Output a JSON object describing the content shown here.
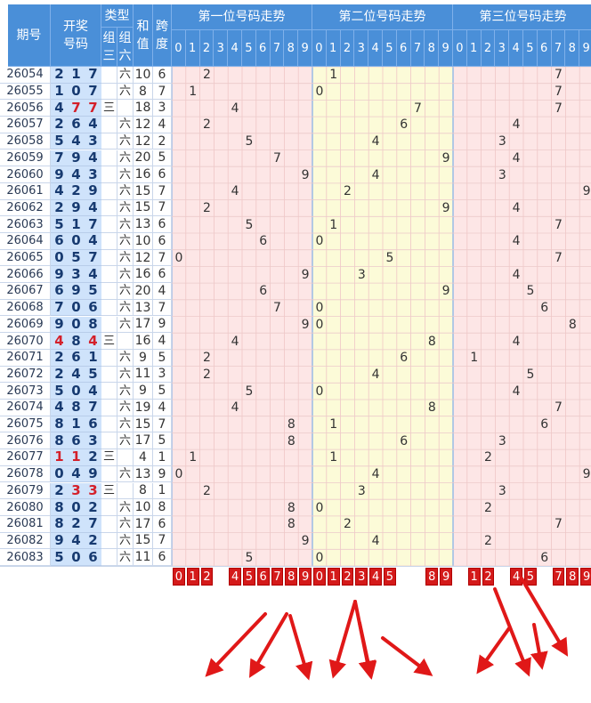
{
  "headers": {
    "issue": "期号",
    "draw_line1": "开奖",
    "draw_line2": "号码",
    "type": "类型",
    "type_g3_line1": "组",
    "type_g3_line2": "三",
    "type_g6_line1": "组",
    "type_g6_line2": "六",
    "sum_line1": "和",
    "sum_line2": "值",
    "span_line1": "跨",
    "span_line2": "度"
  },
  "sections": [
    {
      "title": "第一位号码走势"
    },
    {
      "title": "第二位号码走势"
    },
    {
      "title": "第三位号码走势"
    }
  ],
  "digit_labels": [
    "0",
    "1",
    "2",
    "3",
    "4",
    "5",
    "6",
    "7",
    "8",
    "9"
  ],
  "rows": [
    {
      "issue": "26054",
      "n": [
        "2",
        "1",
        "7"
      ],
      "red": [
        false,
        false,
        false
      ],
      "g3": "",
      "g6": "六",
      "sum": "10",
      "span": "6"
    },
    {
      "issue": "26055",
      "n": [
        "1",
        "0",
        "7"
      ],
      "red": [
        false,
        false,
        false
      ],
      "g3": "",
      "g6": "六",
      "sum": "8",
      "span": "7"
    },
    {
      "issue": "26056",
      "n": [
        "4",
        "7",
        "7"
      ],
      "red": [
        false,
        true,
        true
      ],
      "g3": "三",
      "g6": "",
      "sum": "18",
      "span": "3"
    },
    {
      "issue": "26057",
      "n": [
        "2",
        "6",
        "4"
      ],
      "red": [
        false,
        false,
        false
      ],
      "g3": "",
      "g6": "六",
      "sum": "12",
      "span": "4"
    },
    {
      "issue": "26058",
      "n": [
        "5",
        "4",
        "3"
      ],
      "red": [
        false,
        false,
        false
      ],
      "g3": "",
      "g6": "六",
      "sum": "12",
      "span": "2"
    },
    {
      "issue": "26059",
      "n": [
        "7",
        "9",
        "4"
      ],
      "red": [
        false,
        false,
        false
      ],
      "g3": "",
      "g6": "六",
      "sum": "20",
      "span": "5"
    },
    {
      "issue": "26060",
      "n": [
        "9",
        "4",
        "3"
      ],
      "red": [
        false,
        false,
        false
      ],
      "g3": "",
      "g6": "六",
      "sum": "16",
      "span": "6"
    },
    {
      "issue": "26061",
      "n": [
        "4",
        "2",
        "9"
      ],
      "red": [
        false,
        false,
        false
      ],
      "g3": "",
      "g6": "六",
      "sum": "15",
      "span": "7"
    },
    {
      "issue": "26062",
      "n": [
        "2",
        "9",
        "4"
      ],
      "red": [
        false,
        false,
        false
      ],
      "g3": "",
      "g6": "六",
      "sum": "15",
      "span": "7"
    },
    {
      "issue": "26063",
      "n": [
        "5",
        "1",
        "7"
      ],
      "red": [
        false,
        false,
        false
      ],
      "g3": "",
      "g6": "六",
      "sum": "13",
      "span": "6"
    },
    {
      "issue": "26064",
      "n": [
        "6",
        "0",
        "4"
      ],
      "red": [
        false,
        false,
        false
      ],
      "g3": "",
      "g6": "六",
      "sum": "10",
      "span": "6"
    },
    {
      "issue": "26065",
      "n": [
        "0",
        "5",
        "7"
      ],
      "red": [
        false,
        false,
        false
      ],
      "g3": "",
      "g6": "六",
      "sum": "12",
      "span": "7"
    },
    {
      "issue": "26066",
      "n": [
        "9",
        "3",
        "4"
      ],
      "red": [
        false,
        false,
        false
      ],
      "g3": "",
      "g6": "六",
      "sum": "16",
      "span": "6"
    },
    {
      "issue": "26067",
      "n": [
        "6",
        "9",
        "5"
      ],
      "red": [
        false,
        false,
        false
      ],
      "g3": "",
      "g6": "六",
      "sum": "20",
      "span": "4"
    },
    {
      "issue": "26068",
      "n": [
        "7",
        "0",
        "6"
      ],
      "red": [
        false,
        false,
        false
      ],
      "g3": "",
      "g6": "六",
      "sum": "13",
      "span": "7"
    },
    {
      "issue": "26069",
      "n": [
        "9",
        "0",
        "8"
      ],
      "red": [
        false,
        false,
        false
      ],
      "g3": "",
      "g6": "六",
      "sum": "17",
      "span": "9"
    },
    {
      "issue": "26070",
      "n": [
        "4",
        "8",
        "4"
      ],
      "red": [
        true,
        false,
        true
      ],
      "g3": "三",
      "g6": "",
      "sum": "16",
      "span": "4"
    },
    {
      "issue": "26071",
      "n": [
        "2",
        "6",
        "1"
      ],
      "red": [
        false,
        false,
        false
      ],
      "g3": "",
      "g6": "六",
      "sum": "9",
      "span": "5"
    },
    {
      "issue": "26072",
      "n": [
        "2",
        "4",
        "5"
      ],
      "red": [
        false,
        false,
        false
      ],
      "g3": "",
      "g6": "六",
      "sum": "11",
      "span": "3"
    },
    {
      "issue": "26073",
      "n": [
        "5",
        "0",
        "4"
      ],
      "red": [
        false,
        false,
        false
      ],
      "g3": "",
      "g6": "六",
      "sum": "9",
      "span": "5"
    },
    {
      "issue": "26074",
      "n": [
        "4",
        "8",
        "7"
      ],
      "red": [
        false,
        false,
        false
      ],
      "g3": "",
      "g6": "六",
      "sum": "19",
      "span": "4"
    },
    {
      "issue": "26075",
      "n": [
        "8",
        "1",
        "6"
      ],
      "red": [
        false,
        false,
        false
      ],
      "g3": "",
      "g6": "六",
      "sum": "15",
      "span": "7"
    },
    {
      "issue": "26076",
      "n": [
        "8",
        "6",
        "3"
      ],
      "red": [
        false,
        false,
        false
      ],
      "g3": "",
      "g6": "六",
      "sum": "17",
      "span": "5"
    },
    {
      "issue": "26077",
      "n": [
        "1",
        "1",
        "2"
      ],
      "red": [
        true,
        true,
        false
      ],
      "g3": "三",
      "g6": "",
      "sum": "4",
      "span": "1"
    },
    {
      "issue": "26078",
      "n": [
        "0",
        "4",
        "9"
      ],
      "red": [
        false,
        false,
        false
      ],
      "g3": "",
      "g6": "六",
      "sum": "13",
      "span": "9"
    },
    {
      "issue": "26079",
      "n": [
        "2",
        "3",
        "3"
      ],
      "red": [
        false,
        true,
        true
      ],
      "g3": "三",
      "g6": "",
      "sum": "8",
      "span": "1"
    },
    {
      "issue": "26080",
      "n": [
        "8",
        "0",
        "2"
      ],
      "red": [
        false,
        false,
        false
      ],
      "g3": "",
      "g6": "六",
      "sum": "10",
      "span": "8"
    },
    {
      "issue": "26081",
      "n": [
        "8",
        "2",
        "7"
      ],
      "red": [
        false,
        false,
        false
      ],
      "g3": "",
      "g6": "六",
      "sum": "17",
      "span": "6"
    },
    {
      "issue": "26082",
      "n": [
        "9",
        "4",
        "2"
      ],
      "red": [
        false,
        false,
        false
      ],
      "g3": "",
      "g6": "六",
      "sum": "15",
      "span": "7"
    },
    {
      "issue": "26083",
      "n": [
        "5",
        "0",
        "6"
      ],
      "red": [
        false,
        false,
        false
      ],
      "g3": "",
      "g6": "六",
      "sum": "11",
      "span": "6"
    }
  ],
  "picks": [
    [
      "0",
      "1",
      "2",
      "",
      "4",
      "5",
      "6",
      "7",
      "8",
      "9"
    ],
    [
      "0",
      "1",
      "2",
      "3",
      "4",
      "5",
      "",
      "",
      "8",
      "9"
    ],
    [
      "",
      "1",
      "2",
      "",
      "4",
      "5",
      "",
      "7",
      "8",
      "9"
    ]
  ],
  "colors": {
    "header_blue": "#4a8fd8",
    "number_bg": "#cfe3fb",
    "pos1_bg": "#fde6e6",
    "pos2_bg": "#fcfbd8",
    "pos3_bg": "#fde6e6",
    "pick_red": "#d41a1a",
    "arrow_red": "#e01818",
    "repeat_digit_red": "#d4202a"
  },
  "annotations": {
    "arrow_icon": "red-arrow-icon",
    "arrow_count": 12
  }
}
